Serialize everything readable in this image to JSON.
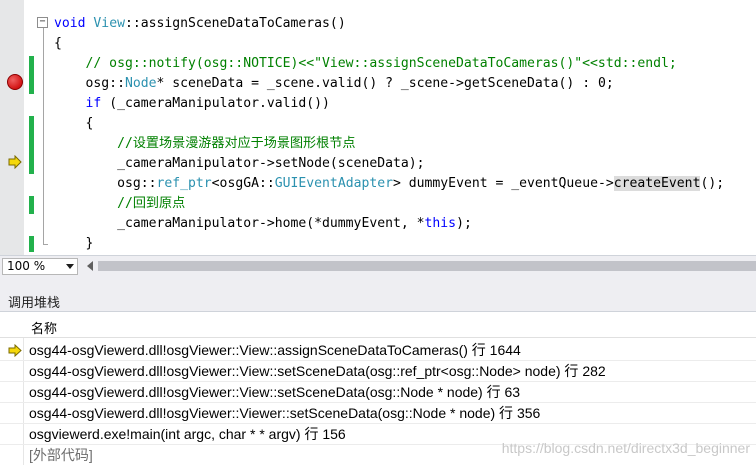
{
  "editor": {
    "lines": [
      [
        {
          "t": "void ",
          "c": "kw"
        },
        {
          "t": "View",
          "c": "type"
        },
        {
          "t": "::assignSceneDataToCameras()",
          "c": ""
        }
      ],
      [
        {
          "t": "{",
          "c": ""
        }
      ],
      [
        {
          "t": "    // osg::notify(osg::NOTICE)<<\"View::assignSceneDataToCameras()\"<<std::endl;",
          "c": "cm"
        }
      ],
      [
        {
          "t": "    osg::",
          "c": ""
        },
        {
          "t": "Node",
          "c": "type"
        },
        {
          "t": "* sceneData = _scene.valid() ? _scene->getSceneData() : 0;",
          "c": ""
        }
      ],
      [
        {
          "t": "    ",
          "c": ""
        },
        {
          "t": "if",
          "c": "kw"
        },
        {
          "t": " (_cameraManipulator.valid())",
          "c": ""
        }
      ],
      [
        {
          "t": "    {",
          "c": ""
        }
      ],
      [
        {
          "t": "        //设置场景漫游器对应于场景图形根节点",
          "c": "cm"
        }
      ],
      [
        {
          "t": "        _cameraManipulator->setNode(sceneData);",
          "c": ""
        }
      ],
      [
        {
          "t": "        osg::",
          "c": ""
        },
        {
          "t": "ref_ptr",
          "c": "type"
        },
        {
          "t": "<osgGA::",
          "c": ""
        },
        {
          "t": "GUIEventAdapter",
          "c": "type"
        },
        {
          "t": "> dummyEvent = _eventQueue->",
          "c": ""
        },
        {
          "t": "createEvent",
          "c": "hl"
        },
        {
          "t": "();",
          "c": ""
        }
      ],
      [
        {
          "t": "        //回到原点",
          "c": "cm"
        }
      ],
      [
        {
          "t": "        _cameraManipulator->home(*dummyEvent, *",
          "c": ""
        },
        {
          "t": "this",
          "c": "kw"
        },
        {
          "t": ");",
          "c": ""
        }
      ],
      [
        {
          "t": "    }",
          "c": ""
        }
      ]
    ],
    "collapse_glyph": "−",
    "breakpoint_line": 4,
    "current_line": 8
  },
  "statusbar": {
    "zoom": "100 %"
  },
  "callstack": {
    "title": "调用堆栈",
    "column_name": "名称",
    "current_row": 0,
    "rows": [
      "osg44-osgViewerd.dll!osgViewer::View::assignSceneDataToCameras() 行 1644",
      "osg44-osgViewerd.dll!osgViewer::View::setSceneData(osg::ref_ptr<osg::Node> node) 行 282",
      "osg44-osgViewerd.dll!osgViewer::View::setSceneData(osg::Node * node) 行 63",
      "osg44-osgViewerd.dll!osgViewer::Viewer::setSceneData(osg::Node * node) 行 356",
      "osgviewerd.exe!main(int argc, char * * argv) 行 156",
      "[外部代码]"
    ],
    "external_row": 5
  },
  "watermark": "https://blog.csdn.net/directx3d_beginner",
  "colors": {
    "keyword": "#0000ff",
    "type": "#2b91af",
    "comment": "#008000",
    "changebar": "#22b14c",
    "breakpoint": "#d21414",
    "exec_arrow": "#f5d80b"
  },
  "icons": {
    "breakpoint": "breakpoint-icon",
    "current_statement": "current-statement-arrow-icon",
    "collapse": "outline-collapse-icon",
    "zoom_dropdown": "chevron-down-icon",
    "scroll_left": "scroll-left-icon"
  }
}
